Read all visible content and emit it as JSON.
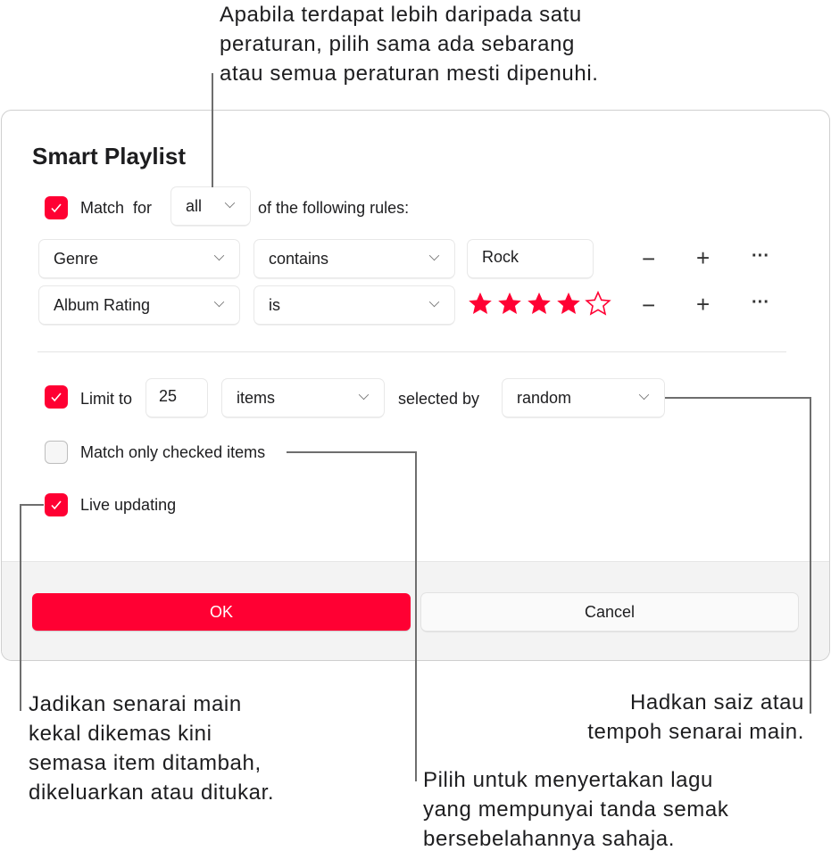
{
  "callouts": {
    "top": [
      "Apabila terdapat lebih daripada satu",
      "peraturan, pilih sama ada sebarang",
      "atau semua peraturan mesti dipenuhi."
    ],
    "live": [
      "Jadikan senarai main",
      "kekal dikemas kini",
      "semasa item ditambah,",
      "dikeluarkan atau ditukar."
    ],
    "limit": [
      "Hadkan saiz atau",
      "tempoh senarai main."
    ],
    "checked": [
      "Pilih untuk menyertakan lagu",
      "yang mempunyai tanda semak",
      "bersebelahannya sahaja."
    ]
  },
  "dialog": {
    "title": "Smart Playlist",
    "match": {
      "checked": true,
      "label": "Match  for",
      "value": "all",
      "suffix": "of the following rules:"
    },
    "rules": [
      {
        "field": "Genre",
        "operator": "contains",
        "value": "Rock"
      },
      {
        "field": "Album Rating",
        "operator": "is",
        "rating": 4,
        "max_rating": 5
      }
    ],
    "limit": {
      "checked": true,
      "label": "Limit to",
      "value": "25",
      "unit": "items",
      "selected_by_label": "selected by",
      "selected_by": "random"
    },
    "match_checked": {
      "checked": false,
      "label": "Match only checked items"
    },
    "live_updating": {
      "checked": true,
      "label": "Live updating"
    },
    "ok": "OK",
    "cancel": "Cancel"
  },
  "colors": {
    "accent": "#ff0033"
  }
}
